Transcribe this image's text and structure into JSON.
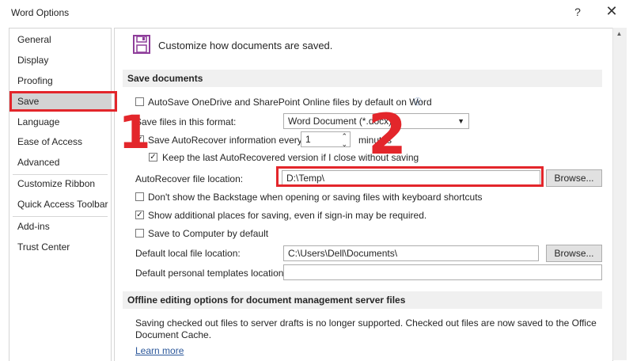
{
  "window": {
    "title": "Word Options",
    "help_icon": "?",
    "close_icon": "✕"
  },
  "nav": {
    "items": [
      {
        "label": "General"
      },
      {
        "label": "Display"
      },
      {
        "label": "Proofing"
      },
      {
        "label": "Save",
        "selected": true
      },
      {
        "label": "Language"
      },
      {
        "label": "Ease of Access"
      },
      {
        "label": "Advanced"
      },
      {
        "label": "Customize Ribbon"
      },
      {
        "label": "Quick Access Toolbar"
      },
      {
        "label": "Add-ins"
      },
      {
        "label": "Trust Center"
      }
    ]
  },
  "header": {
    "text": "Customize how documents are saved.",
    "icon": "floppy-disk-icon"
  },
  "save_documents": {
    "heading": "Save documents",
    "autosave_label": "AutoSave OneDrive and SharePoint Online files by default on Word",
    "autosave_checked": false,
    "format_label": "Save files in this format:",
    "format_value": "Word Document (*.docx)",
    "autorecover_label": "Save AutoRecover information every",
    "autorecover_checked": true,
    "autorecover_minutes": "1",
    "minutes_label": "minutes",
    "keep_last_label": "Keep the last AutoRecovered version if I close without saving",
    "keep_last_checked": true,
    "autorecover_location_label": "AutoRecover file location:",
    "autorecover_location_value": "D:\\Temp\\",
    "browse_label": "Browse...",
    "backstage_label": "Don't show the Backstage when opening or saving files with keyboard shortcuts",
    "backstage_checked": false,
    "additional_places_label": "Show additional places for saving, even if sign-in may be required.",
    "additional_places_checked": true,
    "save_to_computer_label": "Save to Computer by default",
    "save_to_computer_checked": false,
    "default_local_label": "Default local file location:",
    "default_local_value": "C:\\Users\\Dell\\Documents\\",
    "browse2_label": "Browse...",
    "personal_templates_label": "Default personal templates location:",
    "personal_templates_value": ""
  },
  "offline": {
    "heading": "Offline editing options for document management server files",
    "info_line1": "Saving checked out files to server drafts is no longer supported. Checked out files are now saved to the Office",
    "info_line2": "Document Cache.",
    "learn_more": "Learn more"
  },
  "annotations": {
    "step1": "1",
    "step2": "2",
    "color": "#e3262b"
  }
}
